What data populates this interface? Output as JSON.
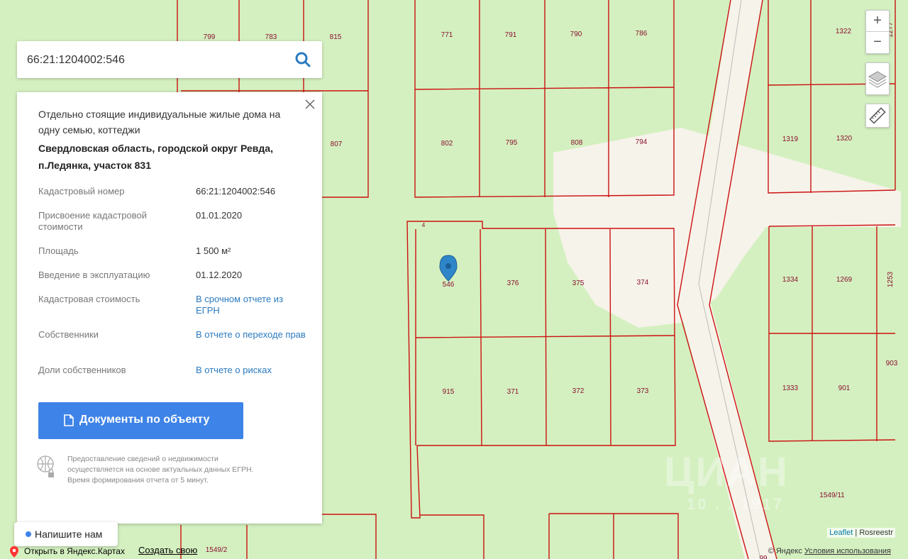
{
  "search": {
    "value": "66:21:1204002:546"
  },
  "card": {
    "type": "Отдельно стоящие индивидуальные жилые дома на одну семью, коттеджи",
    "address": "Свердловская область, городской округ Ревда, п.Ледянка, участок 831",
    "rows": [
      {
        "label": "Кадастровый номер",
        "value": "66:21:1204002:546"
      },
      {
        "label": "Присвоение кадастровой стоимости",
        "value": "01.01.2020"
      },
      {
        "label": "Площадь",
        "value": "1 500 м²"
      },
      {
        "label": "Введение в эксплуатацию",
        "value": "01.12.2020"
      },
      {
        "label": "Кадастровая стоимость",
        "value": "В срочном отчете из ЕГРН"
      },
      {
        "label": "Собственники",
        "value": "В отчете о переходе прав"
      },
      {
        "label": "Доли собственников",
        "value": "В отчете о рисках"
      }
    ],
    "docs_button": "Документы по объекту",
    "note": "Предоставление сведений о недвижимости осуществляется на основе актуальных данных ЕГРН. Время формирования отчета от 5 минут."
  },
  "map": {
    "plots": [
      "799",
      "783",
      "815",
      "771",
      "791",
      "790",
      "786",
      "1322",
      "802",
      "795",
      "808",
      "794",
      "807",
      "1319",
      "1320",
      "4",
      "546",
      "376",
      "375",
      "374",
      "1334",
      "1269",
      "915",
      "371",
      "372",
      "373",
      "1333",
      "901",
      "1253",
      "903",
      "1549/11",
      "1549/2",
      "1277",
      "99"
    ]
  },
  "controls": {
    "zoom_in": "+",
    "zoom_out": "−"
  },
  "chat": {
    "label": "Напишите нам"
  },
  "bottom": {
    "yandex_link": "Открыть в Яндекс.Картах",
    "create_link": "Создать свою"
  },
  "attribution": {
    "leaflet": "Leaflet",
    "rosreestr": "Rosreestr",
    "yandex": "© Яндекс",
    "terms": "Условия использования"
  },
  "watermark": {
    "brand": "ЦИАН",
    "phone": "10 . . 1917"
  },
  "colors": {
    "map_green": "#d4f0c0",
    "road": "#f6f3ea",
    "boundary": "#cc1111",
    "accent": "#3e83e7",
    "link": "#2a7ac0"
  }
}
